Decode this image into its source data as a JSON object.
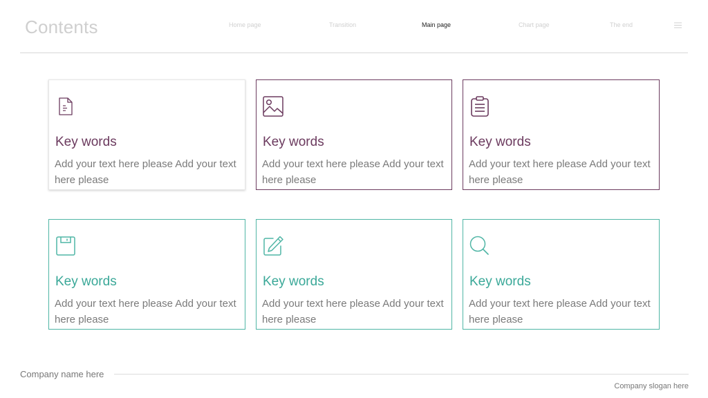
{
  "header": {
    "title": "Contents",
    "nav": [
      {
        "label": "Home  page"
      },
      {
        "label": "Transition"
      },
      {
        "label": "Main page",
        "active": true
      },
      {
        "label": "Chart page"
      },
      {
        "label": "The end"
      }
    ]
  },
  "cards": [
    {
      "icon": "document-icon",
      "heading": "Key words",
      "body": "Add your text here please Add your text here please"
    },
    {
      "icon": "image-icon",
      "heading": "Key words",
      "body": "Add your text here please Add your text here please"
    },
    {
      "icon": "clipboard-icon",
      "heading": "Key words",
      "body": "Add your text here please Add your text here please"
    },
    {
      "icon": "floppy-disk-icon",
      "heading": "Key words",
      "body": "Add your text here please Add your text here please"
    },
    {
      "icon": "edit-pencil-icon",
      "heading": "Key words",
      "body": "Add your text here please Add your text here please"
    },
    {
      "icon": "search-icon",
      "heading": "Key words",
      "body": "Add your text here please Add your text here please"
    }
  ],
  "footer": {
    "company": "Company name here",
    "slogan": "Company slogan here"
  },
  "colors": {
    "purple": "#6b3a5e",
    "teal": "#4fb5a5",
    "text_gray": "#7a7a7a"
  }
}
